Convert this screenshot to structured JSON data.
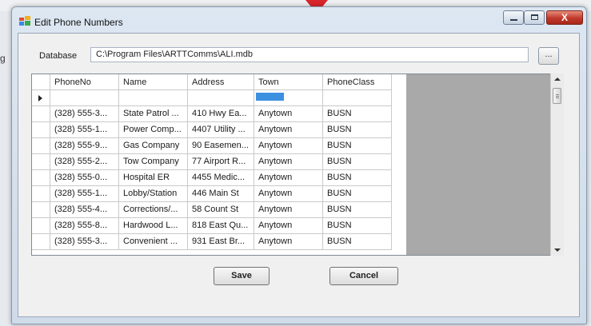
{
  "background": {
    "left_fragment": "g",
    "arrow_color": "#d8262b"
  },
  "window": {
    "title": "Edit Phone Numbers",
    "icon": "window-app-icon",
    "controls": {
      "minimize_icon": "minimize-icon",
      "maximize_icon": "maximize-icon",
      "close_label": "X"
    }
  },
  "database": {
    "label": "Database",
    "path": "C:\\Program Files\\ARTTComms\\ALI.mdb",
    "browse_label": "..."
  },
  "grid": {
    "columns": [
      "PhoneNo",
      "Name",
      "Address",
      "Town",
      "PhoneClass"
    ],
    "rows": [
      [
        "(328) 555-3...",
        "State Patrol ...",
        "410 Hwy Ea...",
        "Anytown",
        "BUSN"
      ],
      [
        "(328) 555-1...",
        "Power Comp...",
        "4407 Utility ...",
        "Anytown",
        "BUSN"
      ],
      [
        "(328) 555-9...",
        "Gas Company",
        "90 Easemen...",
        "Anytown",
        "BUSN"
      ],
      [
        "(328) 555-2...",
        "Tow Company",
        "77 Airport R...",
        "Anytown",
        "BUSN"
      ],
      [
        "(328) 555-0...",
        "Hospital ER",
        "4455 Medic...",
        "Anytown",
        "BUSN"
      ],
      [
        "(328) 555-1...",
        "Lobby/Station",
        "446 Main St",
        "Anytown",
        "BUSN"
      ],
      [
        "(328) 555-4...",
        "Corrections/...",
        "58 Count St",
        "Anytown",
        "BUSN"
      ],
      [
        "(328) 555-8...",
        "Hardwood L...",
        "818 East Qu...",
        "Anytown",
        "BUSN"
      ],
      [
        "(328) 555-3...",
        "Convenient ...",
        "931 East Br...",
        "Anytown",
        "BUSN"
      ]
    ]
  },
  "buttons": {
    "save": "Save",
    "cancel": "Cancel"
  },
  "colors": {
    "selection": "#3d8fe0",
    "grid_empty": "#a9a9a9",
    "close_button": "#c0392b"
  }
}
